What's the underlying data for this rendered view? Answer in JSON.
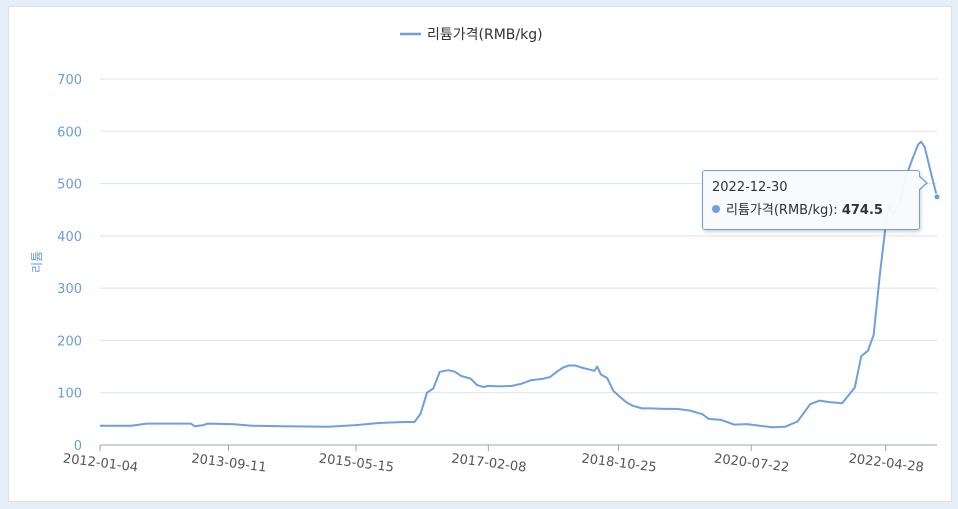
{
  "chart_data": {
    "type": "line",
    "title": "",
    "legend": {
      "label": "리튬가격(RMB/kg)",
      "position": "top-center"
    },
    "xlabel": "",
    "ylabel": "리튬",
    "ylim": [
      0,
      700
    ],
    "y_ticks": [
      "0",
      "100",
      "200",
      "300",
      "400",
      "500",
      "600",
      "700"
    ],
    "x_range": [
      "2012-01-04",
      "2022-12-30"
    ],
    "x_ticks": [
      "2012-01-04",
      "2013-09-11",
      "2015-05-15",
      "2017-02-08",
      "2018-10-25",
      "2020-07-22",
      "2022-04-28"
    ],
    "grid": "horizontal",
    "color": "#6d9fe3",
    "series": [
      {
        "name": "리튬가격(RMB/kg)",
        "points": [
          [
            "2012-01-04",
            37
          ],
          [
            "2012-06-01",
            37
          ],
          [
            "2012-08-15",
            41
          ],
          [
            "2013-01-01",
            41
          ],
          [
            "2013-03-15",
            41
          ],
          [
            "2013-04-01",
            36
          ],
          [
            "2013-05-15",
            38
          ],
          [
            "2013-06-01",
            41
          ],
          [
            "2013-10-01",
            40
          ],
          [
            "2014-01-01",
            37
          ],
          [
            "2014-06-01",
            36
          ],
          [
            "2015-01-01",
            35
          ],
          [
            "2015-05-15",
            38
          ],
          [
            "2015-09-01",
            42
          ],
          [
            "2016-01-01",
            44
          ],
          [
            "2016-02-20",
            44
          ],
          [
            "2016-03-20",
            60
          ],
          [
            "2016-04-20",
            100
          ],
          [
            "2016-05-20",
            108
          ],
          [
            "2016-06-20",
            140
          ],
          [
            "2016-08-01",
            143
          ],
          [
            "2016-09-01",
            140
          ],
          [
            "2016-10-01",
            132
          ],
          [
            "2016-11-15",
            127
          ],
          [
            "2016-12-15",
            115
          ],
          [
            "2017-01-15",
            111
          ],
          [
            "2017-02-08",
            113
          ],
          [
            "2017-04-01",
            112
          ],
          [
            "2017-06-01",
            113
          ],
          [
            "2017-07-15",
            117
          ],
          [
            "2017-09-01",
            124
          ],
          [
            "2017-11-01",
            127
          ],
          [
            "2017-12-01",
            130
          ],
          [
            "2018-01-01",
            140
          ],
          [
            "2018-02-01",
            148
          ],
          [
            "2018-03-01",
            152
          ],
          [
            "2018-04-01",
            152
          ],
          [
            "2018-05-01",
            148
          ],
          [
            "2018-06-01",
            145
          ],
          [
            "2018-07-01",
            142
          ],
          [
            "2018-07-15",
            150
          ],
          [
            "2018-08-01",
            135
          ],
          [
            "2018-09-01",
            128
          ],
          [
            "2018-10-01",
            103
          ],
          [
            "2018-11-01",
            92
          ],
          [
            "2018-12-01",
            82
          ],
          [
            "2019-01-01",
            75
          ],
          [
            "2019-02-15",
            70
          ],
          [
            "2019-04-01",
            70
          ],
          [
            "2019-06-01",
            69
          ],
          [
            "2019-08-01",
            69
          ],
          [
            "2019-10-01",
            66
          ],
          [
            "2019-12-01",
            59
          ],
          [
            "2020-01-01",
            50
          ],
          [
            "2020-03-01",
            48
          ],
          [
            "2020-05-01",
            39
          ],
          [
            "2020-07-01",
            40
          ],
          [
            "2020-09-01",
            37
          ],
          [
            "2020-11-01",
            34
          ],
          [
            "2021-01-01",
            35
          ],
          [
            "2021-03-01",
            45
          ],
          [
            "2021-05-01",
            78
          ],
          [
            "2021-06-15",
            85
          ],
          [
            "2021-08-01",
            82
          ],
          [
            "2021-10-01",
            80
          ],
          [
            "2021-11-01",
            95
          ],
          [
            "2021-12-01",
            110
          ],
          [
            "2022-01-01",
            170
          ],
          [
            "2022-02-01",
            180
          ],
          [
            "2022-03-01",
            210
          ],
          [
            "2022-04-01",
            330
          ],
          [
            "2022-05-01",
            430
          ],
          [
            "2022-05-15",
            460
          ],
          [
            "2022-06-01",
            440
          ],
          [
            "2022-07-01",
            460
          ],
          [
            "2022-08-01",
            510
          ],
          [
            "2022-09-01",
            545
          ],
          [
            "2022-10-01",
            575
          ],
          [
            "2022-10-15",
            580
          ],
          [
            "2022-11-01",
            570
          ],
          [
            "2022-12-01",
            520
          ],
          [
            "2022-12-30",
            474.5
          ]
        ]
      }
    ],
    "tooltip": {
      "date": "2022-12-30",
      "series_label": "리튬가격(RMB/kg):",
      "value": "474.5"
    }
  }
}
